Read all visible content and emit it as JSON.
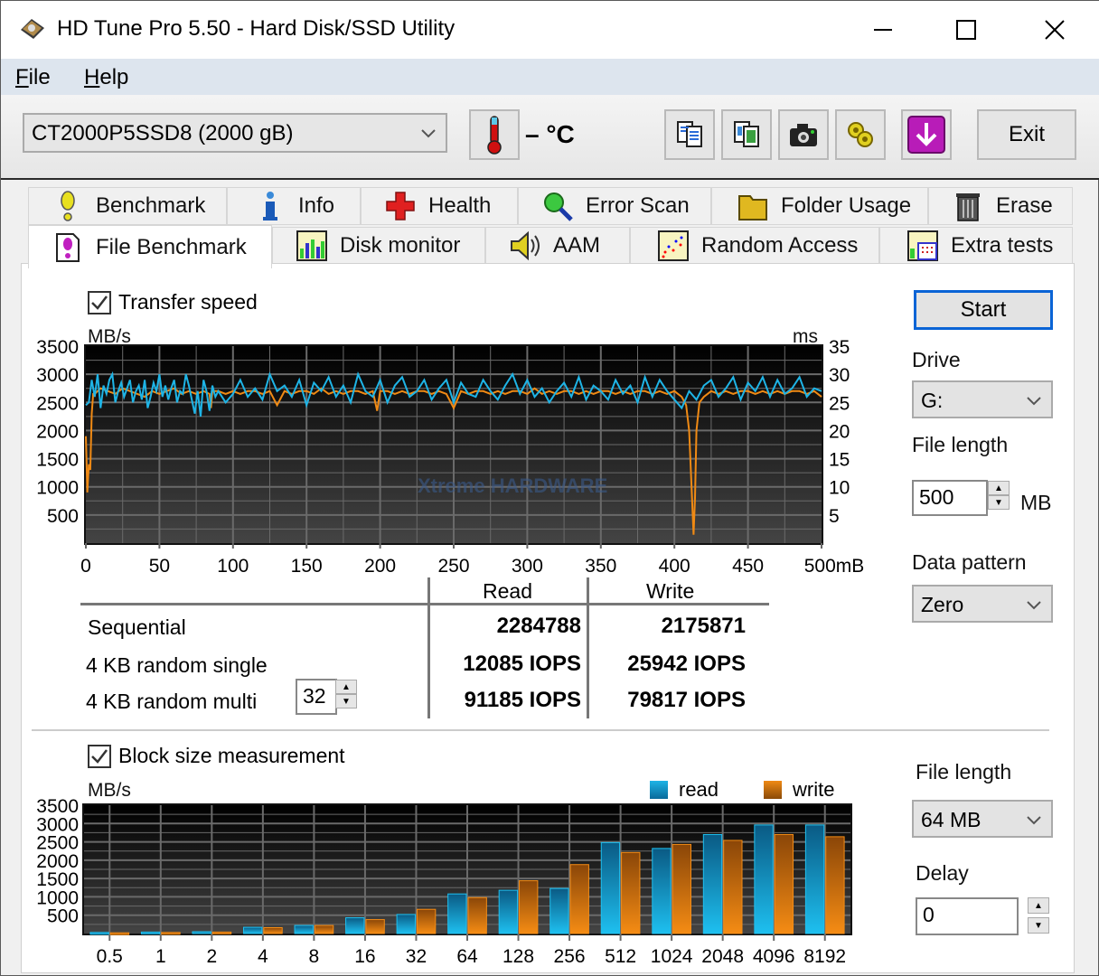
{
  "window": {
    "title": "HD Tune Pro 5.50 - Hard Disk/SSD Utility",
    "minimize_label": "–",
    "maximize_label": "☐",
    "close_label": "✕"
  },
  "menu": {
    "items": [
      {
        "label": "File",
        "accel": "F",
        "rest": "ile"
      },
      {
        "label": "Help",
        "accel": "H",
        "rest": "elp"
      }
    ]
  },
  "toolbar": {
    "drive": "CT2000P5SSD8 (2000 gB)",
    "temperature": "– °C",
    "buttons": [
      "copy-text-icon",
      "copy-screenshot-icon",
      "camera-icon",
      "options-gears-icon",
      "save-download-icon"
    ],
    "exit_label": "Exit"
  },
  "tabs": {
    "row1": [
      {
        "label": "Benchmark",
        "icon": "exclamation-icon"
      },
      {
        "label": "Info",
        "icon": "info-icon"
      },
      {
        "label": "Health",
        "icon": "health-cross-icon"
      },
      {
        "label": "Error Scan",
        "icon": "magnifier-icon"
      },
      {
        "label": "Folder Usage",
        "icon": "folder-icon"
      },
      {
        "label": "Erase",
        "icon": "trash-icon"
      }
    ],
    "row2": [
      {
        "label": "File Benchmark",
        "icon": "file-benchmark-icon",
        "active": true
      },
      {
        "label": "Disk monitor",
        "icon": "disk-monitor-icon"
      },
      {
        "label": "AAM",
        "icon": "speaker-icon"
      },
      {
        "label": "Random Access",
        "icon": "random-access-icon"
      },
      {
        "label": "Extra tests",
        "icon": "extra-tests-icon"
      }
    ]
  },
  "transfer": {
    "checkbox_label": "Transfer speed",
    "checked": true,
    "y_left_unit": "MB/s",
    "y_right_unit": "ms",
    "watermark": "Xtreme HARDWARE"
  },
  "results": {
    "col_read": "Read",
    "col_write": "Write",
    "rows": [
      {
        "label": "Sequential",
        "read": "2284788",
        "write": "2175871"
      },
      {
        "label": "4 KB random single",
        "read": "12085 IOPS",
        "write": "25942 IOPS"
      },
      {
        "label": "4 KB random multi",
        "read": "91185 IOPS",
        "write": "79817 IOPS"
      }
    ],
    "queue_depth": "32"
  },
  "side_top": {
    "start_label": "Start",
    "drive_label": "Drive",
    "drive_value": "G:",
    "file_length_label": "File length",
    "file_length_value": "500",
    "file_length_unit": "MB",
    "data_pattern_label": "Data pattern",
    "data_pattern_value": "Zero"
  },
  "block": {
    "checkbox_label": "Block size measurement",
    "checked": true,
    "y_unit": "MB/s",
    "legend_read": "read",
    "legend_write": "write"
  },
  "side_bottom": {
    "file_length_label": "File length",
    "file_length_value": "64 MB",
    "delay_label": "Delay",
    "delay_value": "0"
  },
  "colors": {
    "read": "#1eb4e6",
    "write": "#f08a14",
    "accent": "#0a64d6"
  },
  "chart_data": [
    {
      "type": "line",
      "title": "Transfer speed",
      "xlabel": "mB",
      "ylabel": "MB/s",
      "ylabel_right": "ms",
      "xlim": [
        0,
        500
      ],
      "ylim": [
        0,
        3500
      ],
      "ylim_right": [
        0,
        35
      ],
      "x_ticks": [
        "0",
        "50",
        "100",
        "150",
        "200",
        "250",
        "300",
        "350",
        "400",
        "450",
        "500mB"
      ],
      "y_ticks": [
        "500",
        "1000",
        "1500",
        "2000",
        "2500",
        "3000",
        "3500"
      ],
      "y_ticks_right": [
        "5",
        "10",
        "15",
        "20",
        "25",
        "30",
        "35"
      ],
      "grid": true,
      "series": [
        {
          "name": "read",
          "x": [
            0,
            2,
            4,
            6,
            8,
            10,
            12,
            14,
            16,
            18,
            20,
            22,
            24,
            26,
            28,
            30,
            32,
            34,
            36,
            38,
            40,
            42,
            44,
            46,
            48,
            50,
            52,
            54,
            56,
            58,
            60,
            62,
            64,
            66,
            68,
            70,
            72,
            74,
            76,
            78,
            80,
            82,
            84,
            86,
            88,
            90,
            95,
            100,
            105,
            110,
            115,
            120,
            125,
            130,
            135,
            140,
            145,
            150,
            155,
            160,
            165,
            170,
            175,
            180,
            185,
            190,
            195,
            200,
            205,
            210,
            215,
            220,
            225,
            230,
            235,
            240,
            245,
            250,
            255,
            260,
            265,
            270,
            275,
            280,
            285,
            290,
            295,
            300,
            305,
            310,
            315,
            320,
            325,
            330,
            335,
            340,
            345,
            350,
            355,
            360,
            365,
            370,
            375,
            380,
            385,
            390,
            395,
            400,
            405,
            410,
            415,
            420,
            425,
            430,
            435,
            440,
            445,
            450,
            455,
            460,
            465,
            470,
            475,
            480,
            485,
            490,
            495,
            500
          ],
          "y": [
            2450,
            2500,
            2900,
            2600,
            3000,
            2400,
            2800,
            2650,
            2900,
            3000,
            2500,
            2700,
            2850,
            2600,
            2750,
            2900,
            2500,
            2700,
            2800,
            2550,
            2900,
            2400,
            2600,
            2850,
            2700,
            3000,
            2600,
            2800,
            2550,
            2750,
            2900,
            2500,
            2700,
            2650,
            3000,
            2800,
            2550,
            2300,
            2700,
            2250,
            2900,
            2700,
            2350,
            2800,
            2600,
            2700,
            2500,
            2650,
            2900,
            2600,
            2750,
            2550,
            3000,
            2700,
            2800,
            2600,
            2900,
            2450,
            2850,
            2700,
            2950,
            2600,
            2800,
            2500,
            3000,
            2700,
            2600,
            2900,
            2500,
            2800,
            2950,
            2600,
            2700,
            2900,
            2550,
            2750,
            2900,
            2500,
            2850,
            2650,
            2600,
            2900,
            2700,
            2550,
            2800,
            3000,
            2650,
            2900,
            2600,
            2750,
            2500,
            2700,
            2850,
            2600,
            2950,
            2550,
            2800,
            2700,
            2550,
            2900,
            2650,
            2800,
            2500,
            2950,
            2600,
            2900,
            2700,
            2550,
            2400,
            2700,
            2550,
            2800,
            2900,
            2600,
            2750,
            2950,
            2550,
            2850,
            2700,
            2950,
            2600,
            2900,
            2650,
            2750,
            2950,
            2600,
            2750,
            2700
          ]
        },
        {
          "name": "write",
          "x": [
            0,
            1,
            2,
            3,
            4,
            5,
            6,
            10,
            15,
            20,
            25,
            30,
            35,
            40,
            45,
            50,
            55,
            60,
            65,
            70,
            75,
            80,
            84,
            85,
            86,
            90,
            95,
            100,
            105,
            110,
            115,
            120,
            125,
            130,
            135,
            140,
            145,
            150,
            155,
            160,
            165,
            170,
            175,
            180,
            185,
            190,
            195,
            198,
            200,
            205,
            210,
            215,
            220,
            225,
            230,
            235,
            240,
            245,
            250,
            255,
            260,
            265,
            270,
            275,
            280,
            285,
            290,
            295,
            300,
            305,
            310,
            315,
            320,
            325,
            330,
            335,
            340,
            345,
            350,
            355,
            360,
            365,
            370,
            375,
            380,
            385,
            390,
            395,
            400,
            405,
            408,
            410,
            412,
            413,
            414,
            415,
            417,
            420,
            425,
            430,
            435,
            440,
            445,
            450,
            455,
            460,
            465,
            470,
            475,
            480,
            485,
            490,
            495,
            500
          ],
          "y": [
            1900,
            900,
            1400,
            1300,
            2300,
            2650,
            2650,
            2750,
            2700,
            2650,
            2750,
            2700,
            2650,
            2600,
            2700,
            2650,
            2700,
            2750,
            2650,
            2700,
            2650,
            2700,
            2650,
            2400,
            2700,
            2700,
            2650,
            2700,
            2650,
            2700,
            2700,
            2650,
            2700,
            2450,
            2700,
            2650,
            2700,
            2700,
            2650,
            2750,
            2650,
            2700,
            2650,
            2700,
            2700,
            2650,
            2700,
            2350,
            2700,
            2700,
            2650,
            2700,
            2650,
            2700,
            2700,
            2650,
            2700,
            2650,
            2400,
            2700,
            2650,
            2700,
            2700,
            2650,
            2700,
            2650,
            2700,
            2700,
            2650,
            2750,
            2650,
            2700,
            2650,
            2700,
            2700,
            2650,
            2700,
            2650,
            2700,
            2700,
            2650,
            2700,
            2650,
            2700,
            2700,
            2650,
            2700,
            2650,
            2700,
            2600,
            2450,
            2000,
            800,
            150,
            800,
            2000,
            2500,
            2600,
            2700,
            2650,
            2700,
            2650,
            2700,
            2700,
            2650,
            2700,
            2650,
            2700,
            2650,
            2700,
            2700,
            2650,
            2700,
            2600
          ]
        }
      ]
    },
    {
      "type": "bar",
      "title": "Block size measurement",
      "ylabel": "MB/s",
      "ylim": [
        0,
        3500
      ],
      "y_ticks": [
        "500",
        "1000",
        "1500",
        "2000",
        "2500",
        "3000",
        "3500"
      ],
      "categories": [
        "0.5",
        "1",
        "2",
        "4",
        "8",
        "16",
        "32",
        "64",
        "128",
        "256",
        "512",
        "1024",
        "2048",
        "4096",
        "8192"
      ],
      "legend": "top-right",
      "grid": true,
      "series": [
        {
          "name": "read",
          "values": [
            30,
            40,
            50,
            170,
            220,
            430,
            520,
            1080,
            1180,
            1230,
            2480,
            2320,
            2700,
            2960,
            2960
          ]
        },
        {
          "name": "write",
          "values": [
            20,
            30,
            40,
            160,
            220,
            380,
            660,
            980,
            1440,
            1880,
            2210,
            2430,
            2540,
            2700,
            2640
          ]
        }
      ]
    }
  ]
}
